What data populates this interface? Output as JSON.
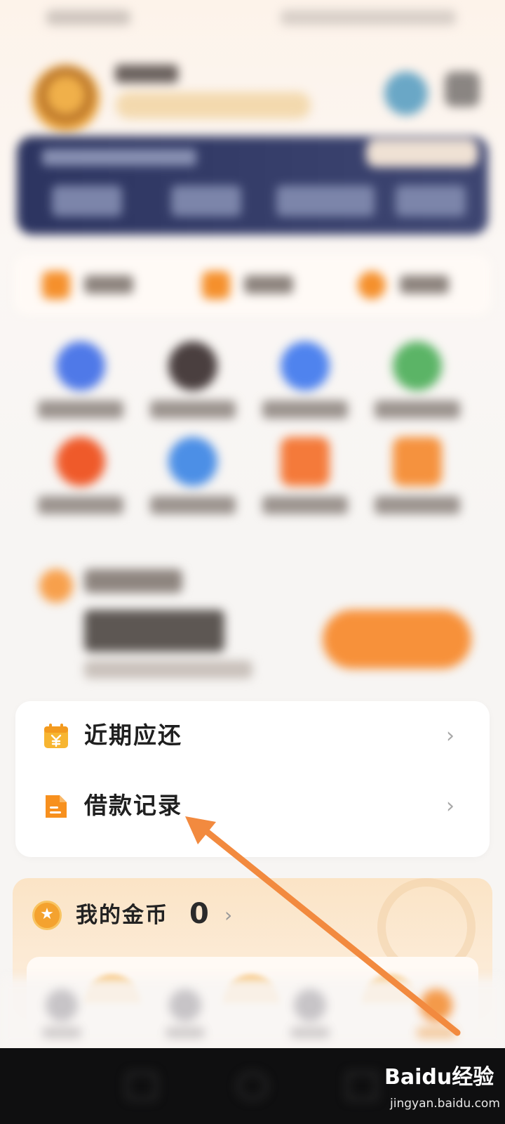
{
  "menu": {
    "items": [
      {
        "label": "近期应还",
        "icon": "calendar-yen-icon"
      },
      {
        "label": "借款记录",
        "icon": "document-icon"
      }
    ]
  },
  "coins": {
    "label": "我的金币",
    "value": "0",
    "icon": "star-coin-icon"
  },
  "watermark": {
    "brand": "Baidu经验",
    "url": "jingyan.baidu.com"
  },
  "colors": {
    "accent": "#f7913a",
    "annotation_arrow": "#f28a3f",
    "vip_banner": "#2c3460"
  }
}
